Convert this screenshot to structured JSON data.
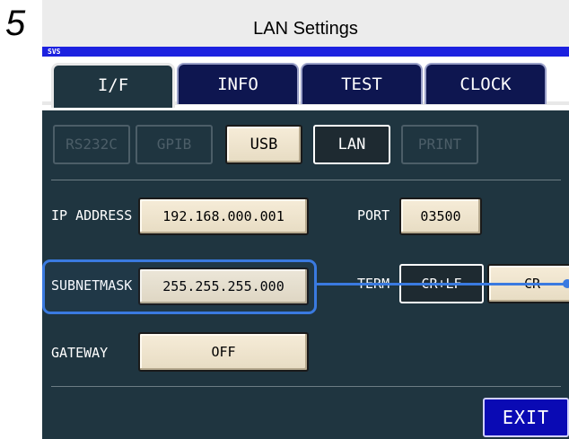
{
  "step_number": "5",
  "caption": "LAN Settings",
  "title_bar": "SVS",
  "tabs": [
    "I/F",
    "INFO",
    "TEST",
    "CLOCK"
  ],
  "interfaces": [
    "RS232C",
    "GPIB",
    "USB",
    "LAN",
    "PRINT"
  ],
  "ip_address": {
    "label": "IP ADDRESS",
    "value": "192.168.000.001"
  },
  "port": {
    "label": "PORT",
    "value": "03500"
  },
  "subnet_mask": {
    "label": "SUBNETMASK",
    "value": "255.255.255.000"
  },
  "term": {
    "label": "TERM",
    "options": [
      "CR+LF",
      "CR"
    ]
  },
  "gateway": {
    "label": "GATEWAY",
    "value": "OFF"
  },
  "exit_label": "EXIT",
  "colors": {
    "accent": "#3a7ae0",
    "title_bar": "#1c21e0",
    "screen": "#1f3540"
  }
}
